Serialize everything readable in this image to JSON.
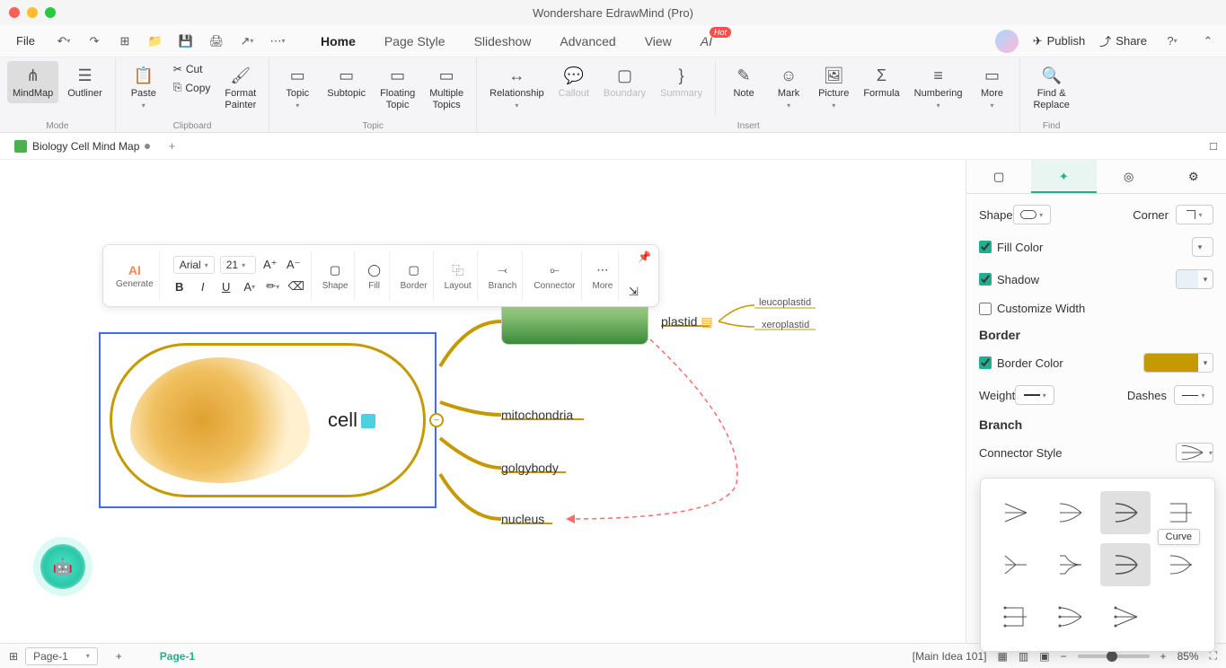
{
  "titlebar": {
    "title": "Wondershare EdrawMind (Pro)"
  },
  "menubar": {
    "file": "File",
    "tabs": [
      "Home",
      "Page Style",
      "Slideshow",
      "Advanced",
      "View",
      "AI"
    ],
    "active_tab": "Home",
    "hot": "Hot",
    "publish": "Publish",
    "share": "Share"
  },
  "ribbon": {
    "mode": {
      "label": "Mode",
      "mindmap": "MindMap",
      "outliner": "Outliner"
    },
    "clipboard": {
      "label": "Clipboard",
      "paste": "Paste",
      "cut": "Cut",
      "copy": "Copy",
      "format_painter": "Format\nPainter"
    },
    "topic": {
      "label": "Topic",
      "topic": "Topic",
      "subtopic": "Subtopic",
      "floating": "Floating\nTopic",
      "multiple": "Multiple\nTopics"
    },
    "insert": {
      "label": "Insert",
      "relationship": "Relationship",
      "callout": "Callout",
      "boundary": "Boundary",
      "summary": "Summary",
      "note": "Note",
      "mark": "Mark",
      "picture": "Picture",
      "formula": "Formula",
      "numbering": "Numbering",
      "more": "More"
    },
    "find": {
      "label": "Find",
      "find_replace": "Find &\nReplace"
    }
  },
  "doc_tabs": {
    "name": "Biology Cell Mind Map"
  },
  "float_toolbar": {
    "ai": "AI",
    "generate": "Generate",
    "font": "Arial",
    "size": "21",
    "shape": "Shape",
    "fill": "Fill",
    "border": "Border",
    "layout": "Layout",
    "branch": "Branch",
    "connector": "Connector",
    "more": "More"
  },
  "mindmap": {
    "root": "cell",
    "children": [
      "plastid",
      "mitochondria",
      "golgybody",
      "nucleus"
    ],
    "plastid_children": [
      "leucoplastid",
      "xeroplastid"
    ]
  },
  "right_panel": {
    "shape": "Shape",
    "corner": "Corner",
    "fill_color": "Fill Color",
    "shadow": "Shadow",
    "customize_width": "Customize Width",
    "border": "Border",
    "border_color": "Border Color",
    "weight": "Weight",
    "dashes": "Dashes",
    "branch": "Branch",
    "connector_style": "Connector Style",
    "border_color_value": "#c49a00"
  },
  "conn_popup": {
    "tooltip": "Curve"
  },
  "statusbar": {
    "page_select": "Page-1",
    "page_tab": "Page-1",
    "status": "[Main Idea 101]",
    "zoom": "85%"
  }
}
